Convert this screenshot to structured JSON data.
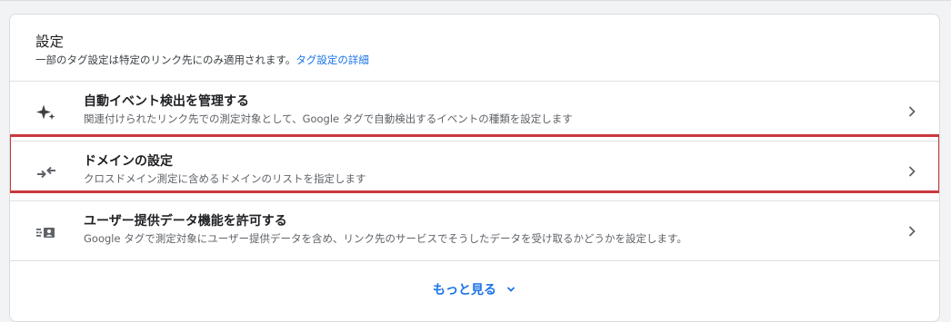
{
  "settings": {
    "title": "設定",
    "description": "一部のタグ設定は特定のリンク先にのみ適用されます。",
    "details_link": "タグ設定の詳細",
    "items": [
      {
        "title": "自動イベント検出を管理する",
        "description": "関連付けられたリンク先での測定対象として、Google タグで自動検出するイベントの種類を設定します",
        "icon": "sparkle-icon"
      },
      {
        "title": "ドメインの設定",
        "description": "クロスドメイン測定に含めるドメインのリストを指定します",
        "icon": "arrows-merge-icon",
        "highlighted": true
      },
      {
        "title": "ユーザー提供データ機能を許可する",
        "description": "Google タグで測定対象にユーザー提供データを含め、リンク先のサービスでそうしたデータを受け取るかどうかを設定します。",
        "icon": "user-data-icon"
      }
    ],
    "show_more": "もっと見る"
  },
  "colors": {
    "link": "#1a73e8",
    "highlight_border": "#c9393c",
    "icon": "#5f6368"
  }
}
